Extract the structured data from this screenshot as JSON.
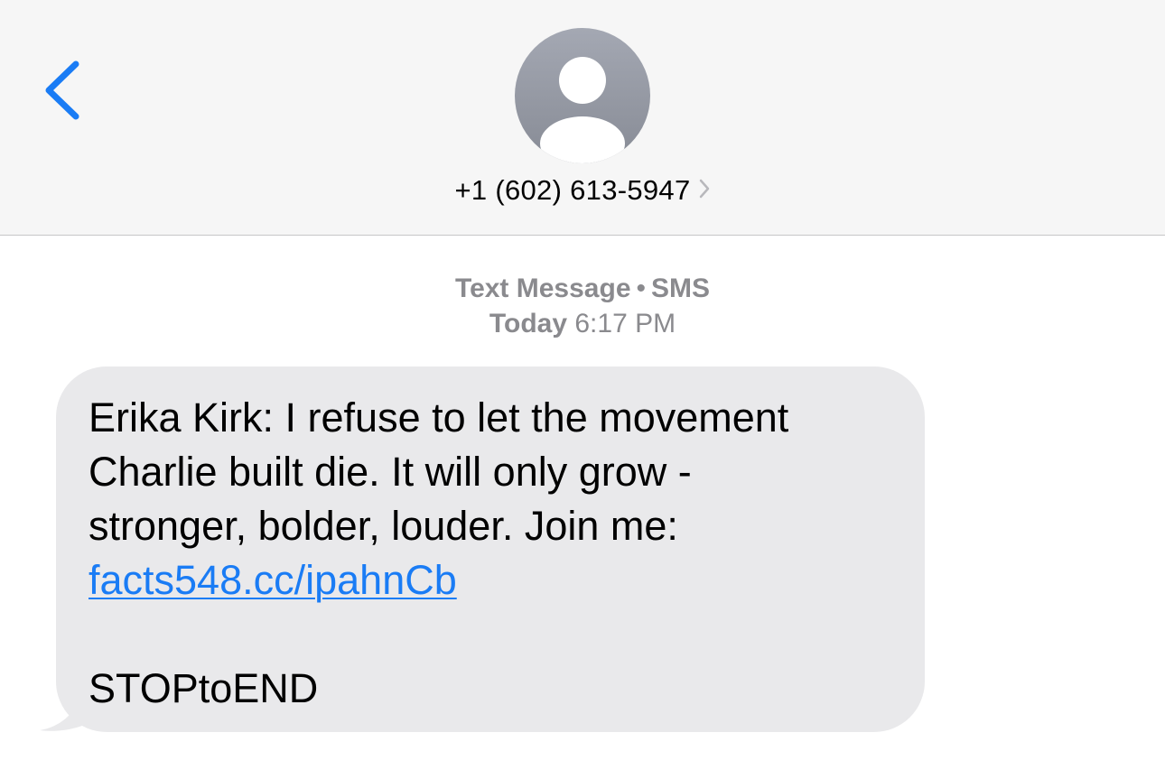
{
  "header": {
    "back_icon": "chevron-left-icon",
    "avatar_icon": "person-silhouette-icon",
    "contact_name": "+1 (602) 613-5947",
    "contact_chevron_icon": "chevron-right-icon"
  },
  "thread": {
    "service_label": "Text Message",
    "separator": "•",
    "service_type": "SMS",
    "day_label": "Today",
    "time_label": "6:17 PM"
  },
  "message": {
    "line1": "Erika Kirk: I refuse to let the movement",
    "line2": "Charlie built die. It will only grow -",
    "line3": "stronger, bolder, louder. Join me:",
    "link": "facts548.cc/ipahnCb",
    "footer": "STOPtoEND"
  },
  "colors": {
    "accent": "#1a7cf5",
    "header_bg": "#f6f6f6",
    "bubble_bg": "#e9e9eb",
    "meta_text": "#8a8a8e",
    "avatar_top": "#a4a8b3",
    "avatar_bottom": "#878b95"
  }
}
